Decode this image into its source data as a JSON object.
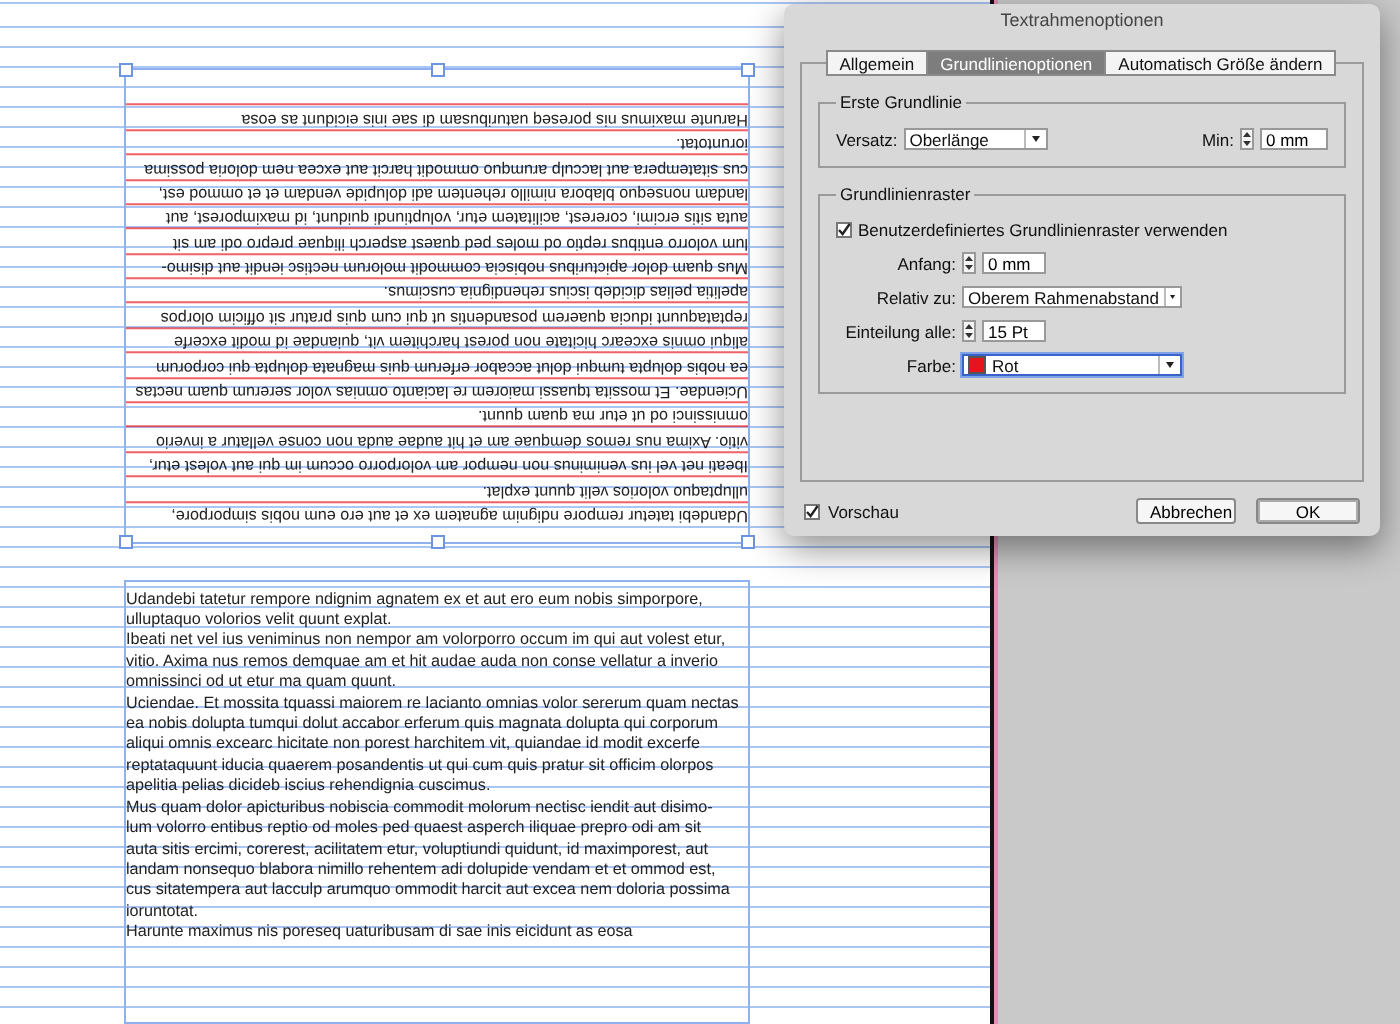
{
  "dialog": {
    "title": "Textrahmenoptionen",
    "tabs": [
      {
        "label": "Allgemein",
        "selected": false
      },
      {
        "label": "Grundlinienoptionen",
        "selected": true
      },
      {
        "label": "Automatisch Größe ändern",
        "selected": false
      }
    ],
    "first_baseline": {
      "title": "Erste Grundlinie",
      "offset_label": "Versatz:",
      "offset_value": "Oberlänge",
      "min_label": "Min:",
      "min_value": "0 mm"
    },
    "baseline_grid": {
      "title": "Grundlinienraster",
      "custom_grid_label": "Benutzerdefiniertes Grundlinienraster verwenden",
      "custom_grid_checked": true,
      "start_label": "Anfang:",
      "start_value": "0 mm",
      "relative_label": "Relativ zu:",
      "relative_value": "Oberem Rahmenabstand",
      "increment_label": "Einteilung alle:",
      "increment_value": "15 Pt",
      "color_label": "Farbe:",
      "color_value": "Rot",
      "color": "#e8141b"
    },
    "preview_label": "Vorschau",
    "preview_checked": true,
    "buttons": [
      {
        "label": "Abbrechen",
        "kind": "secondary"
      },
      {
        "label": "OK",
        "kind": "default"
      }
    ]
  },
  "rotated_frame": {
    "lines": [
      "Udandebi tatetur rempore ndignim agnatem ex et aut ero eum nobis simporpore,",
      "ulluptaquo volorios velit quunt explat.",
      "Ibeati net vel ius veniminus non nempor am volorporro occum im qui aut volest etur,",
      "vitio. Axima nus remos demquae am et hit audae auda non conse vellatur a inverio",
      "omnissinci od ut etur ma quam quunt.",
      "Uciendae. Et mossita tquassi maiorem re lacianto omnias volor sererum quam nectas",
      "ea nobis dolupta tumqui dolut accabor erferum quis magnata dolupta qui corporum",
      "aliqui omnis excearc hicitate non porest harchitem vit, quiandae id modit excerfe",
      "reptataquunt iducia quaerem posandentis ut qui cum quis pratur sit officim olorpos",
      "apelitia pelias dicideb iscius rehendignia cuscimus.",
      "Mus quam dolor apicturibus nobiscia commodit molorum nectisc iendit aut disimo-",
      "lum volorro entibus reptio od moles ped quaest asperch iliquae prepro odi am sit",
      "auta sitis ercimi, corerest, acilitatem etur, voluptiundi quidunt, id maximporest, aut",
      "landam nonsequo blabora nimillo rehentem adi dolupide vendam et et ommod est,",
      "cus sitatempera aut lacculp arumquo ommodit harcit aut excea nem doloria possima",
      "ioruntotat.",
      "Harunte maximus nis poreseq uaturibusam di sae inis eicidunt as eosa"
    ]
  },
  "text_frame": {
    "lines": [
      "Udandebi tatetur rempore ndignim agnatem ex et aut ero eum nobis simporpore,",
      "ulluptaquo volorios velit quunt explat.",
      "Ibeati net vel ius veniminus non nempor am volorporro occum im qui aut volest etur,",
      "vitio. Axima nus remos demquae am et hit audae auda non conse vellatur a inverio",
      "omnissinci od ut etur ma quam quunt.",
      "Uciendae. Et mossita tquassi maiorem re lacianto omnias volor sererum quam nectas",
      "ea nobis dolupta tumqui dolut accabor erferum quis magnata dolupta qui corporum",
      "aliqui omnis excearc hicitate non porest harchitem vit, quiandae id modit excerfe",
      "reptataquunt iducia quaerem posandentis ut qui cum quis pratur sit officim olorpos",
      "apelitia pelias dicideb iscius rehendignia cuscimus.",
      "Mus quam dolor apicturibus nobiscia commodit molorum nectisc iendit aut disimo-",
      "lum volorro entibus reptio od moles ped quaest asperch iliquae prepro odi am sit",
      "auta sitis ercimi, corerest, acilitatem etur, voluptiundi quidunt, id maximporest, aut",
      "landam nonsequo blabora nimillo rehentem adi dolupide vendam et et ommod est,",
      "cus sitatempera aut lacculp arumquo ommodit harcit aut excea nem doloria possima",
      "ioruntotat.",
      "Harunte maximus nis poreseq uaturibusam di sae inis eicidunt as eosa"
    ]
  }
}
